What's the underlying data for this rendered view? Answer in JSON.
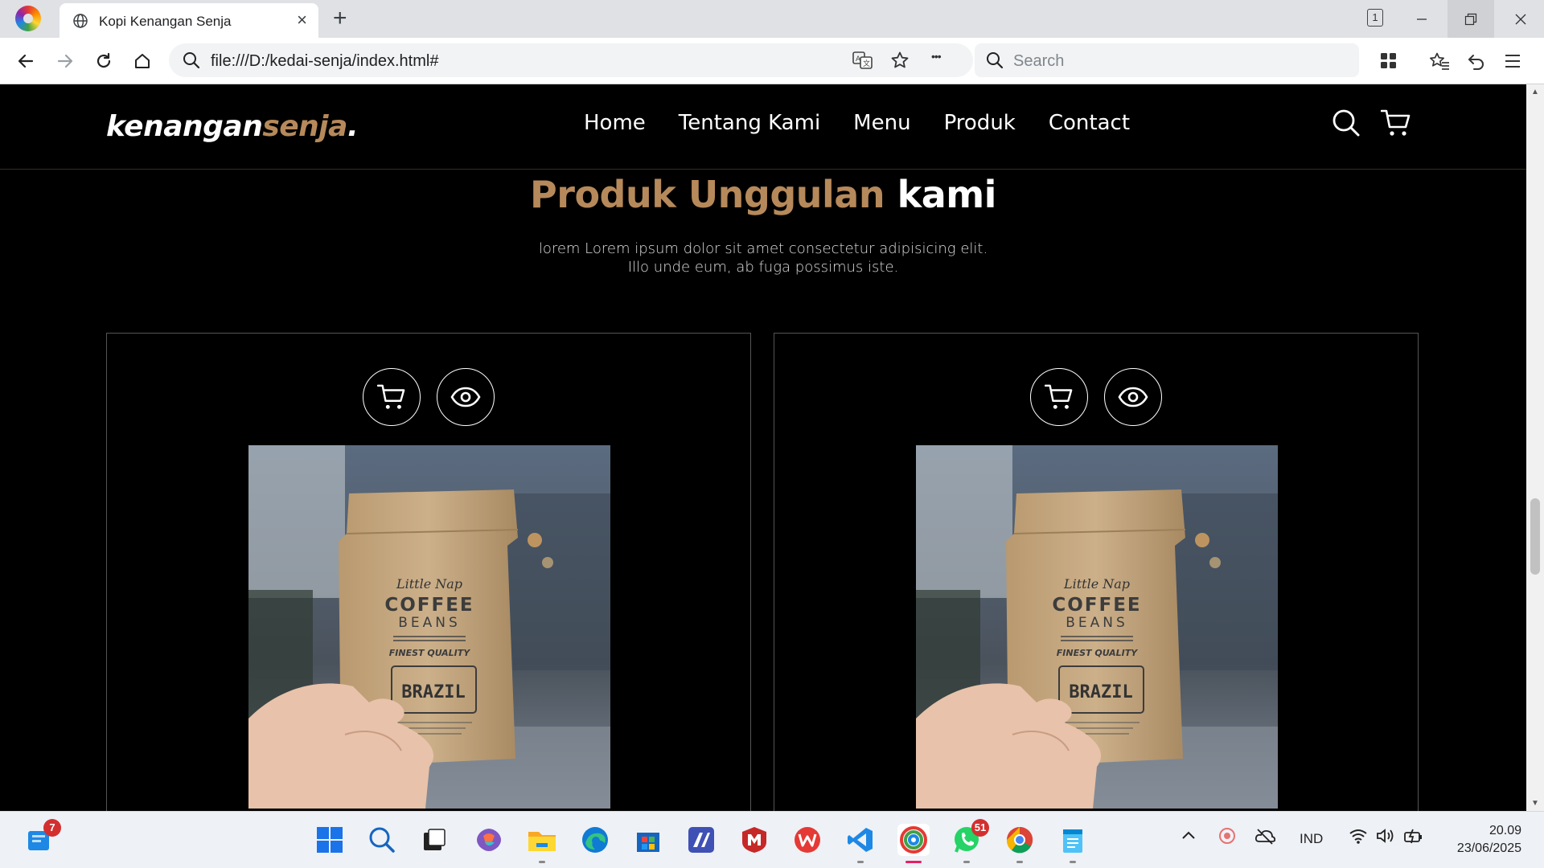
{
  "browser": {
    "tab_title": "Kopi Kenangan Senja",
    "new_tab": "+",
    "tab_count": "1",
    "url": "file:///D:/kedai-senja/index.html#",
    "search_placeholder": "Search",
    "more_dots": "•••"
  },
  "site": {
    "logo_part1": "kenangan",
    "logo_part2": "senja",
    "logo_dot": ".",
    "nav": [
      "Home",
      "Tentang Kami",
      "Menu",
      "Produk",
      "Contact"
    ]
  },
  "section": {
    "title_highlight": "Produk Unggulan",
    "title_rest": "kami",
    "desc_line1": "lorem Lorem ipsum dolor sit amet consectetur adipisicing elit.",
    "desc_line2": "Illo unde eum, ab fuga possimus iste."
  },
  "products": [
    {
      "bag_brand": "Little Nap",
      "bag_title": "COFFEE",
      "bag_sub": "BEANS",
      "bag_quality": "FINEST QUALITY",
      "bag_origin": "BRAZIL"
    },
    {
      "bag_brand": "Little Nap",
      "bag_title": "COFFEE",
      "bag_sub": "BEANS",
      "bag_quality": "FINEST QUALITY",
      "bag_origin": "BRAZIL"
    }
  ],
  "taskbar": {
    "widgets_badge": "7",
    "whatsapp_badge": "51",
    "language": "IND",
    "time": "20.09",
    "date": "23/06/2025"
  },
  "colors": {
    "accent": "#b6895b",
    "background": "#000000"
  }
}
